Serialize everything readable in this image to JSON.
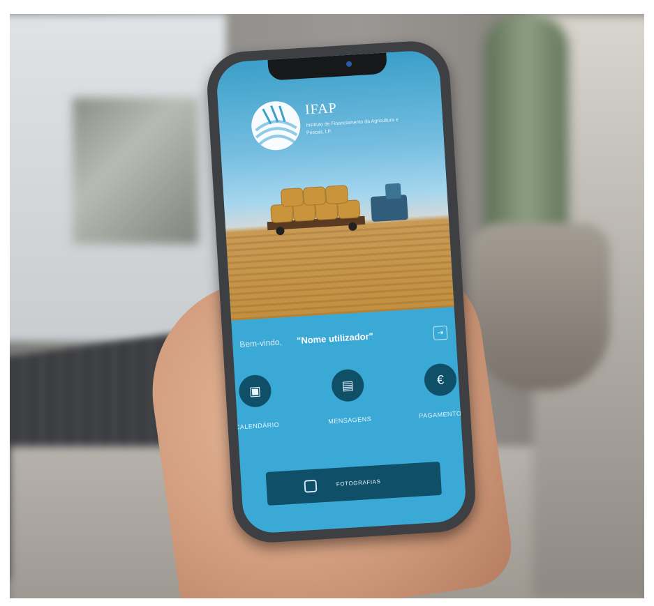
{
  "app": {
    "logo_name": "IFAP",
    "logo_subtitle": "Instituto de Financiamento da Agricultura e Pescas, I.P."
  },
  "welcome": {
    "prefix": "Bem-vindo,",
    "user_name": "\"Nome utilizador\"",
    "exit_icon": "logout-icon"
  },
  "menu": {
    "items": [
      {
        "label": "CALENDÁRIO",
        "icon": "calendar-icon"
      },
      {
        "label": "MENSAGENS",
        "icon": "message-icon"
      },
      {
        "label": "PAGAMENTOS",
        "icon": "euro-icon"
      }
    ]
  },
  "cta": {
    "label": "FOTOGRAFIAS",
    "icon": "camera-icon"
  },
  "colors": {
    "screen_bg": "#3aa9d6",
    "button_dark": "#0f4f68",
    "text_light": "#e6f6fd"
  }
}
